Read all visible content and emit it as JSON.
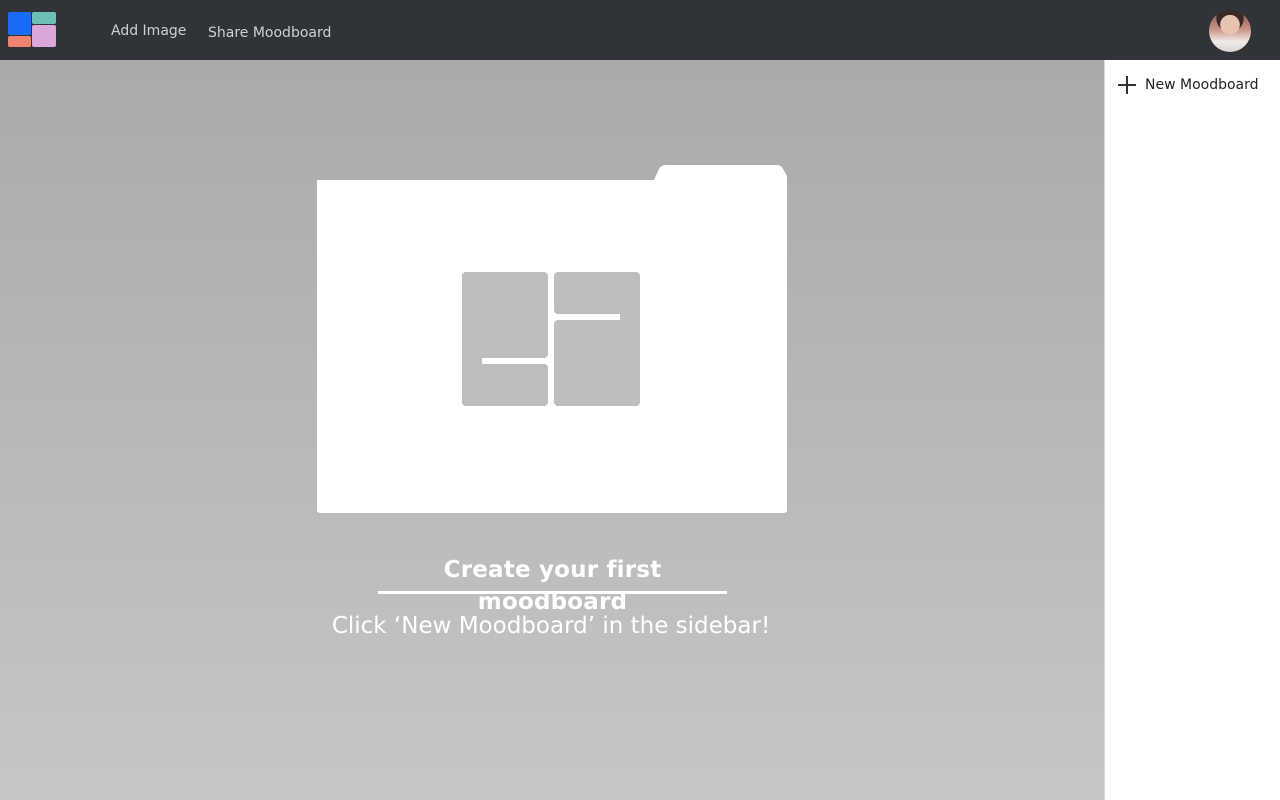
{
  "app": {
    "logo_icon": "moodboard-logo-icon",
    "logo_colors": [
      "#1a6cf5",
      "#6ec0b4",
      "#f28270",
      "#dba6d9"
    ]
  },
  "header": {
    "add_image_label": "Add Image",
    "share_label": "Share Moodboard",
    "avatar_icon": "user-avatar"
  },
  "sidebar": {
    "new_moodboard_label": "New Moodboard",
    "new_moodboard_icon": "plus-icon"
  },
  "empty_state": {
    "illustration_icon": "folder-grid-icon",
    "title": "Create your first moodboard",
    "subtitle": "Click ‘New Moodboard’ in the sidebar!"
  },
  "colors": {
    "topbar": "#303337",
    "main_top": "#aaaaaa",
    "main_bottom": "#c6c6c6",
    "folder": "#ffffff",
    "grid_tile": "#bdbdbd"
  }
}
